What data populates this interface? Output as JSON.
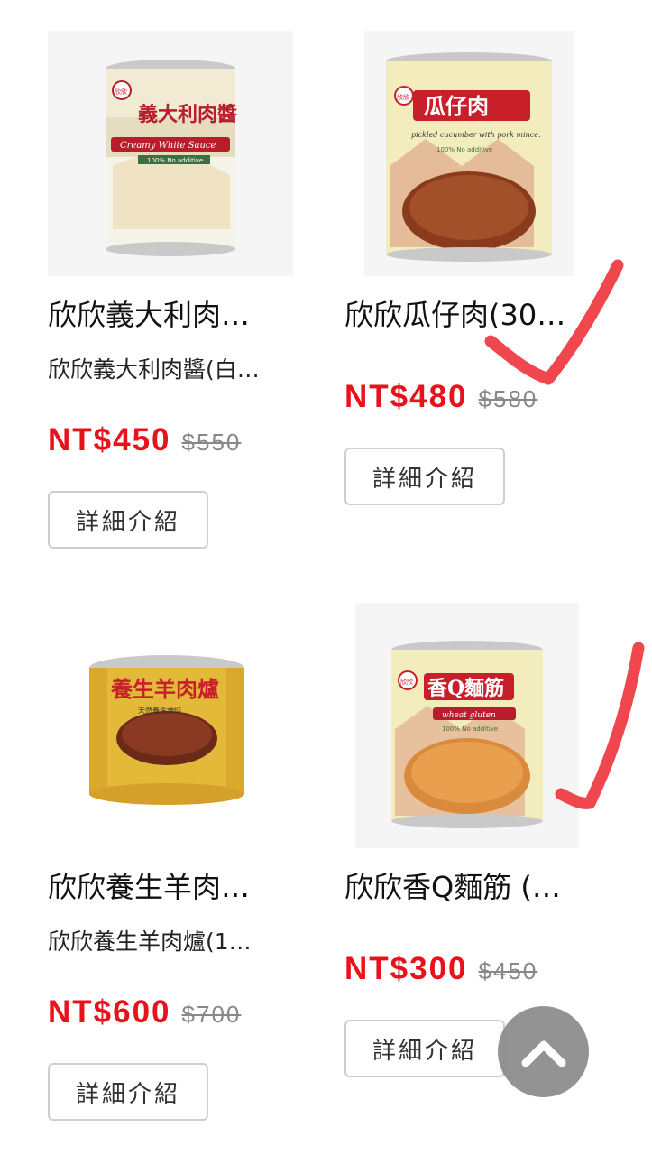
{
  "products": [
    {
      "name": "欣欣義大利肉…",
      "subtitle": "欣欣義大利肉醬(白…",
      "price": "NT$450",
      "old_price": "$550",
      "button": "詳細介紹",
      "label_title": "義大利肉醬",
      "label_sub": "Creamy White Sauce",
      "label_tag": "100% No additive",
      "brand_mark": "欣欣"
    },
    {
      "name": "欣欣瓜仔肉(30…",
      "subtitle": "",
      "price": "NT$480",
      "old_price": "$580",
      "button": "詳細介紹",
      "label_title": "瓜仔肉",
      "label_sub": "pickled cucumber with pork mince.",
      "label_tag": "100% No additive",
      "brand_mark": "欣欣"
    },
    {
      "name": "欣欣養生羊肉…",
      "subtitle": "欣欣養生羊肉爐(1…",
      "price": "NT$600",
      "old_price": "$700",
      "button": "詳細介紹",
      "label_title": "養生羊肉爐",
      "label_tag": "天然養生頭炖"
    },
    {
      "name": "欣欣香Q麵筋 (…",
      "subtitle": "",
      "price": "NT$300",
      "old_price": "$450",
      "button": "詳細介紹",
      "label_title": "香Q麵筋",
      "label_sub": "wheat gluten",
      "label_tag": "100% No additive",
      "brand_mark": "欣欣"
    }
  ],
  "colors": {
    "price_red": "#e8121b",
    "check_red": "#f0464e",
    "scroll_button": "#8a8a8a"
  },
  "icons": {
    "scroll_top": "chevron-up-icon",
    "check": "check-mark-annotation"
  }
}
